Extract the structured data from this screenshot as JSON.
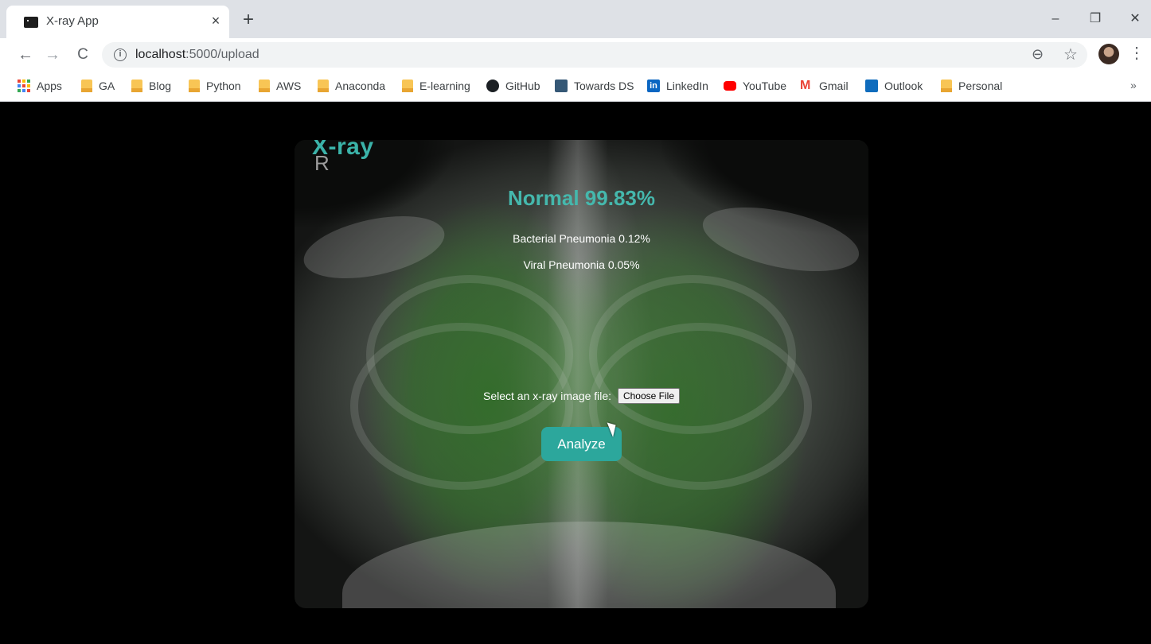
{
  "browser": {
    "tab_title": "X-ray App",
    "tab_close": "×",
    "new_tab": "+",
    "url_host": "localhost",
    "url_path": ":5000/upload",
    "window_controls": {
      "minimize": "–",
      "maximize": "❐",
      "close": "✕"
    }
  },
  "bookmarks": [
    {
      "label": "Apps",
      "icon": "apps-grid-icon"
    },
    {
      "label": "GA",
      "icon": "folder-icon"
    },
    {
      "label": "Blog",
      "icon": "folder-icon"
    },
    {
      "label": "Python",
      "icon": "folder-icon"
    },
    {
      "label": "AWS",
      "icon": "folder-icon"
    },
    {
      "label": "Anaconda",
      "icon": "folder-icon"
    },
    {
      "label": "E-learning",
      "icon": "folder-icon"
    },
    {
      "label": "GitHub",
      "icon": "github-icon"
    },
    {
      "label": "Towards DS",
      "icon": "towards-ds-icon"
    },
    {
      "label": "LinkedIn",
      "icon": "linkedin-icon"
    },
    {
      "label": "YouTube",
      "icon": "youtube-icon"
    },
    {
      "label": "Gmail",
      "icon": "gmail-icon"
    },
    {
      "label": "Outlook",
      "icon": "outlook-icon"
    },
    {
      "label": "Personal",
      "icon": "folder-icon"
    }
  ],
  "bookmarks_more": "»",
  "app": {
    "logo_main": "X-ray",
    "logo_sub": "R",
    "result_main": "Normal 99.83%",
    "result_secondary_1": "Bacterial Pneumonia 0.12%",
    "result_secondary_2": "Viral Pneumonia 0.05%",
    "file_label": "Select an x-ray image file:",
    "choose_file_label": "Choose File",
    "analyze_label": "Analyze",
    "accent_color": "#2ca79c"
  }
}
